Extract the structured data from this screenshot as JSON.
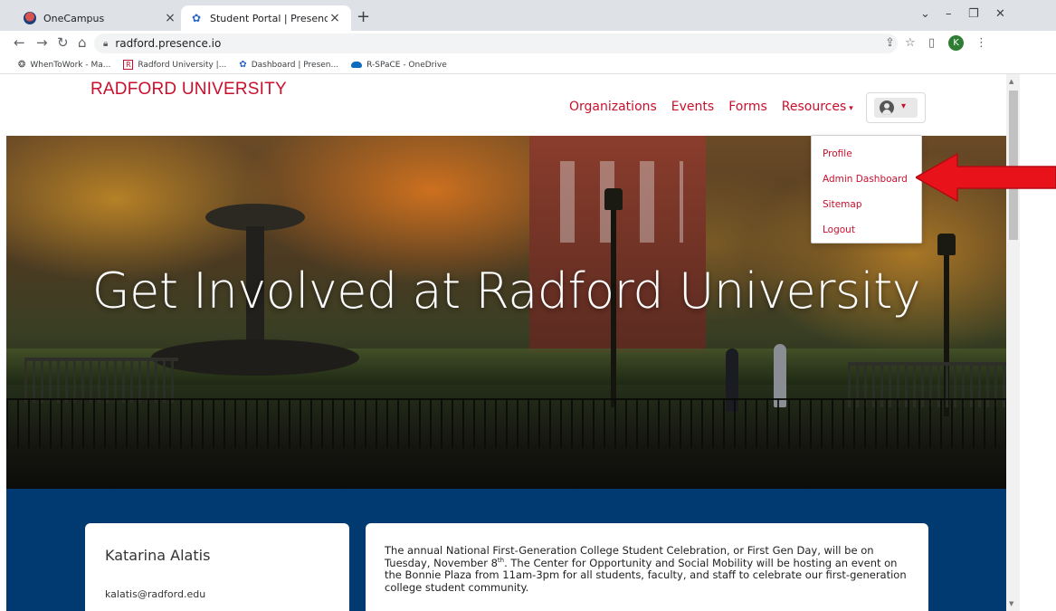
{
  "browser": {
    "tabs": [
      {
        "title": "OneCampus",
        "active": false
      },
      {
        "title": "Student Portal | Presence",
        "active": true
      }
    ],
    "address": "radford.presence.io",
    "profile_initial": "K",
    "bookmarks": [
      {
        "label": "WhenToWork - Ma...",
        "icon": "whentowork-icon"
      },
      {
        "label": "Radford University |...",
        "icon": "radford-r-icon"
      },
      {
        "label": "Dashboard | Presen...",
        "icon": "presence-icon"
      },
      {
        "label": "R-SPaCE - OneDrive",
        "icon": "onedrive-cloud-icon"
      }
    ]
  },
  "site": {
    "brand": "RADFORD UNIVERSITY",
    "nav": {
      "organizations": "Organizations",
      "events": "Events",
      "forms": "Forms",
      "resources": "Resources"
    },
    "user_menu": {
      "items": [
        "Profile",
        "Admin Dashboard",
        "Sitemap",
        "Logout"
      ]
    },
    "hero_title": "Get Involved at Radford University",
    "profile_card": {
      "name": "Katarina Alatis",
      "email": "kalatis@radford.edu"
    },
    "announcement": {
      "part1": "The annual National First-Generation College Student Celebration, or First Gen Day, will be on Tuesday, November 8",
      "sup": "th",
      "part2": ". The Center for Opportunity and Social Mobility will be hosting an event on the Bonnie Plaza from 11am-3pm for all students, faculty, and staff to celebrate our first-generation college student community."
    }
  },
  "colors": {
    "brand_red": "#c8102e",
    "band_blue": "#003a70",
    "annotation_arrow": "#e8121a"
  }
}
